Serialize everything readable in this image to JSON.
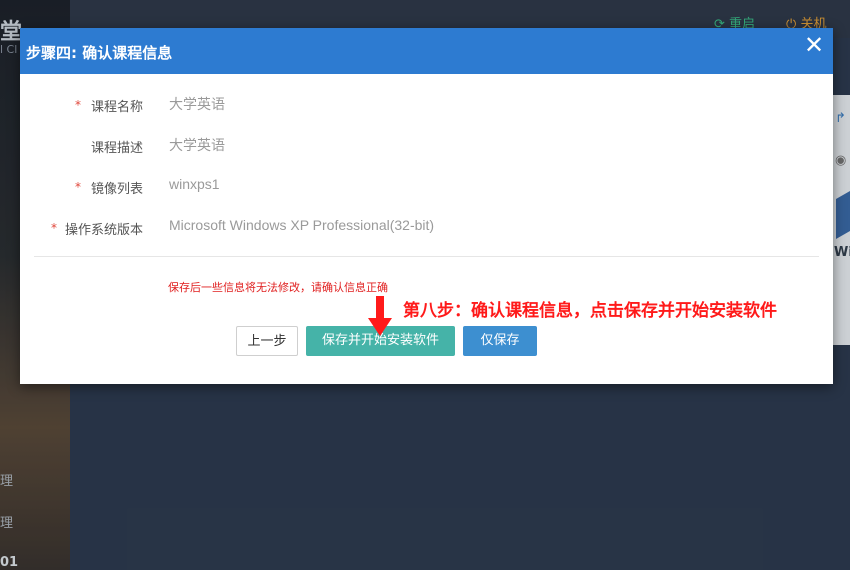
{
  "background": {
    "brand_title": "堂",
    "brand_sub": "l Cl",
    "nav_items": [
      "理",
      "理",
      "01"
    ],
    "header_restart": "重启",
    "header_shutdown": "关机",
    "right_edge_text": "Wi"
  },
  "modal": {
    "title": "步骤四: 确认课程信息",
    "fields": [
      {
        "label": "课程名称",
        "value": "大学英语",
        "required": true
      },
      {
        "label": "课程描述",
        "value": "大学英语",
        "required": false
      },
      {
        "label": "镜像列表",
        "value": "winxps1",
        "required": true
      },
      {
        "label": "操作系统版本",
        "value": "Microsoft Windows XP Professional(32-bit)",
        "required": true
      }
    ],
    "warning": "保存后一些信息将无法修改，请确认信息正确",
    "buttons": {
      "prev": "上一步",
      "save_install": "保存并开始安装软件",
      "save_only": "仅保存"
    }
  },
  "annotation": "第八步：确认课程信息，点击保存并开始安装软件",
  "colors": {
    "header_blue": "#2d7bd1",
    "save_install_teal": "#45b3a8",
    "save_only_blue": "#3d8fd0",
    "annotation_red": "#ff1a1a"
  },
  "icons": {
    "close": "close-icon",
    "restart": "refresh-icon",
    "shutdown": "power-icon",
    "arrow": "arrow-down-icon"
  }
}
